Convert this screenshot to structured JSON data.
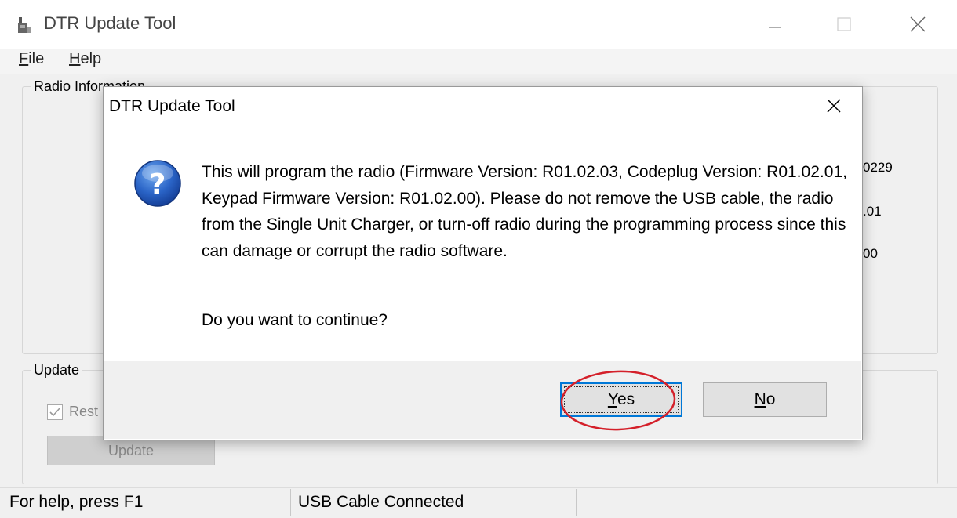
{
  "window": {
    "title": "DTR Update Tool",
    "menu": [
      "File",
      "Help"
    ]
  },
  "radio_info": {
    "group_label": "Radio Information",
    "partial_values": [
      "0229",
      ".01",
      "00"
    ]
  },
  "update_group": {
    "group_label": "Update",
    "checkbox_label": "Rest",
    "button_label": "Update"
  },
  "status_bar": {
    "help_text": "For help, press F1",
    "connection": "USB Cable Connected"
  },
  "dialog": {
    "title": "DTR Update Tool",
    "icon": "question-icon",
    "message": "This will program the radio (Firmware Version: R01.02.03, Codeplug Version: R01.02.01, Keypad Firmware Version: R01.02.00). Please do not remove the USB cable, the radio from the Single Unit Charger, or turn-off radio during the programming process since this can damage or corrupt the radio software.",
    "question": "Do you want to continue?",
    "yes_label": "Yes",
    "no_label": "No"
  },
  "colors": {
    "focus_border": "#0078d7",
    "annotation": "#d4202a",
    "question_icon": "#1f5fbf"
  }
}
